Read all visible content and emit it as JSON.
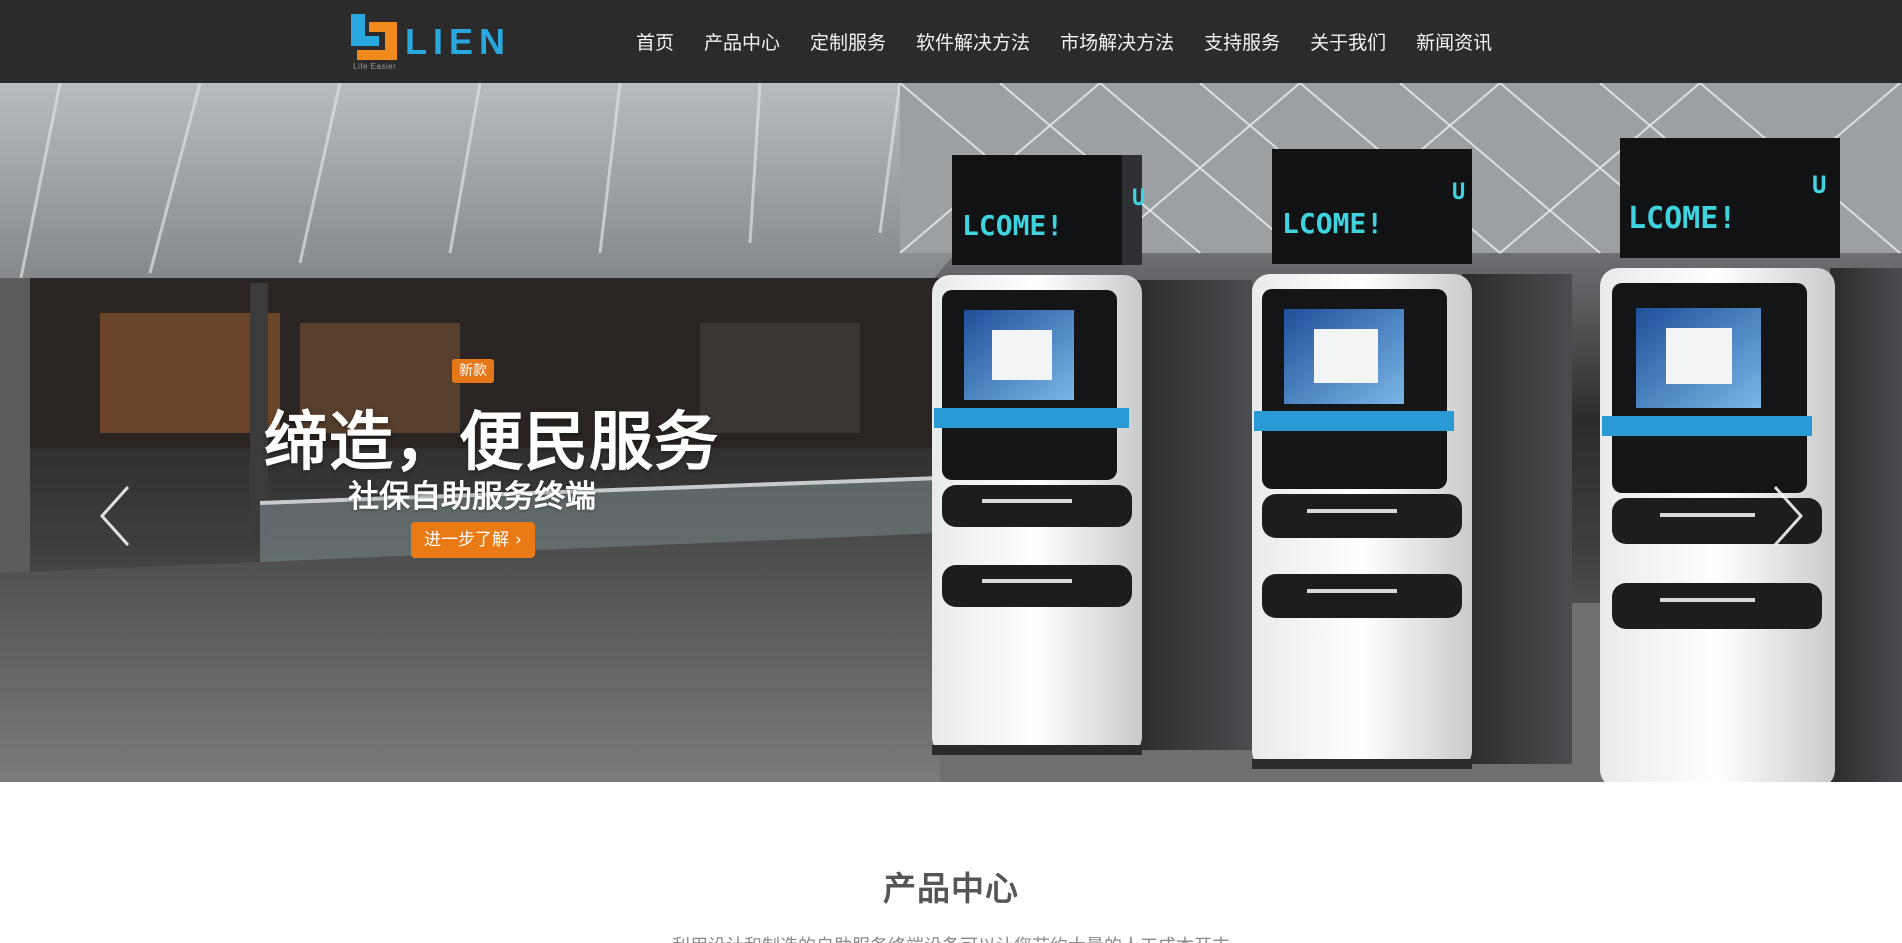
{
  "header": {
    "logo_text": "LIEN",
    "logo_tagline": "Life Easier",
    "nav": [
      {
        "label": "首页"
      },
      {
        "label": "产品中心"
      },
      {
        "label": "定制服务"
      },
      {
        "label": "软件解决方法"
      },
      {
        "label": "市场解决方法"
      },
      {
        "label": "支持服务"
      },
      {
        "label": "关于我们"
      },
      {
        "label": "新闻资讯"
      }
    ]
  },
  "banner": {
    "tag": "新款",
    "title": "缔造，便民服务",
    "subtitle": "社保自助服务终端",
    "button_label": "进一步了解",
    "button_icon": "chevron-right-icon",
    "kiosk_screen_text": "LCOME!",
    "kiosk_side_char": "U",
    "slide_count": 3,
    "active_slide": 1
  },
  "section": {
    "title": "产品中心",
    "description": "利用设计和制造的自助服务终端设备可以让您节约大量的人工成本开支"
  },
  "colors": {
    "header_bg": "#2b2b2b",
    "logo_blue": "#29a8e0",
    "logo_orange": "#f08a1c",
    "accent_orange": "#ea7a16",
    "kiosk_screen_cyan": "#3fd3e0"
  }
}
